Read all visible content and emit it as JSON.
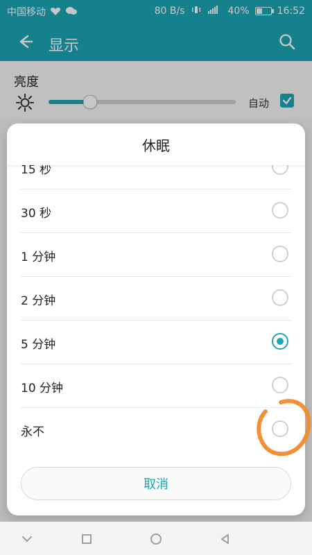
{
  "status_bar": {
    "carrier": "中国移动",
    "net_speed": "80 B/s",
    "battery_percent": "40%",
    "battery_level": 0.4,
    "time": "16:52",
    "icons": [
      "heart-icon",
      "wechat-icon",
      "vibrate-icon",
      "lte-signal-icon",
      "battery-icon"
    ]
  },
  "header": {
    "title": "显示",
    "back_icon": "arrow-left-icon",
    "search_icon": "search-icon"
  },
  "brightness": {
    "label": "亮度",
    "auto_label": "自动",
    "auto_checked": true,
    "value": 0.22
  },
  "dialog": {
    "title": "休眠",
    "options": [
      {
        "label": "15 秒",
        "checked": false
      },
      {
        "label": "30 秒",
        "checked": false
      },
      {
        "label": "1 分钟",
        "checked": false
      },
      {
        "label": "2 分钟",
        "checked": false
      },
      {
        "label": "5 分钟",
        "checked": true
      },
      {
        "label": "10 分钟",
        "checked": false
      },
      {
        "label": "永不",
        "checked": false
      }
    ],
    "cancel_label": "取消"
  },
  "colors": {
    "accent": "#1aa6b5",
    "annotation": "#f08a2b"
  },
  "nav": {
    "icons": [
      "chevron-down-icon",
      "recent-apps-icon",
      "home-icon",
      "back-icon"
    ]
  }
}
